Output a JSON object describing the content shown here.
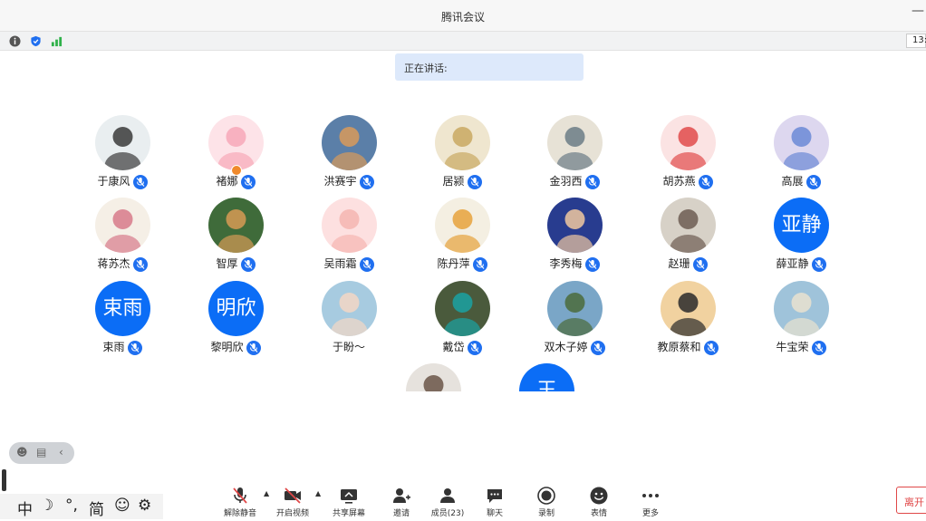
{
  "window": {
    "title": "腾讯会议",
    "minimize_glyph": "—"
  },
  "statusbar": {
    "time": "13:"
  },
  "speaking": {
    "label": "正在讲话:"
  },
  "participants": [
    {
      "name": "于康风"
    },
    {
      "name": "褚娜"
    },
    {
      "name": "洪赛宇"
    },
    {
      "name": "居颍"
    },
    {
      "name": "金羽西"
    },
    {
      "name": "胡苏燕"
    },
    {
      "name": "高展"
    },
    {
      "name": "蒋苏杰"
    },
    {
      "name": "智厚"
    },
    {
      "name": "吴雨霜"
    },
    {
      "name": "陈丹萍"
    },
    {
      "name": "李秀梅"
    },
    {
      "name": "赵珊"
    },
    {
      "name": "薛亚静",
      "avatar_text": "亚静"
    },
    {
      "name": "束雨",
      "avatar_text": "束雨"
    },
    {
      "name": "黎明欣",
      "avatar_text": "明欣"
    },
    {
      "name": "于盼～"
    },
    {
      "name": "戴岱"
    },
    {
      "name": "双木子婷"
    },
    {
      "name": "教原蔡和"
    },
    {
      "name": "牛宝荣"
    },
    {
      "name": ""
    },
    {
      "name": "",
      "avatar_text": "王"
    }
  ],
  "ime": {
    "chinese": "中",
    "moon": "☽",
    "punct": "°,",
    "simplified": "简",
    "emoji": "☺",
    "gear": "⚙"
  },
  "toolbar": {
    "unmute": "解除静音",
    "video": "开启视频",
    "share": "共享屏幕",
    "invite": "邀请",
    "members": "成员(23)",
    "chat": "聊天",
    "record": "录制",
    "reactions": "表情",
    "more": "更多"
  },
  "leave": {
    "label": "离开"
  },
  "colors": {
    "accent": "#1f6ff0",
    "avatar_blue": "#0b6df6",
    "leave_red": "#e04848",
    "speaking_bg": "#dde9fb"
  }
}
